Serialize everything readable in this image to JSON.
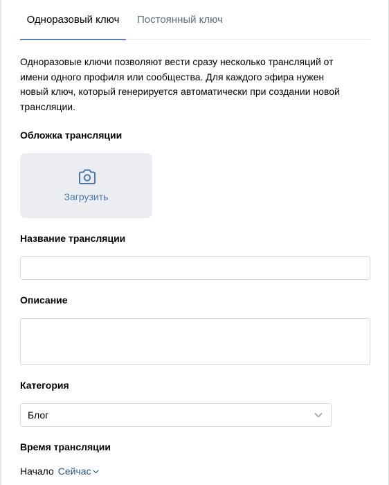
{
  "tabs": [
    {
      "label": "Одноразовый ключ",
      "active": true
    },
    {
      "label": "Постоянный ключ",
      "active": false
    }
  ],
  "intro": "Одноразовые ключи позволяют вести сразу несколько трансляций от имени одного профиля или сообщества. Для каждого эфира нужен новый ключ, который генерируется автоматически при создании новой трансляции.",
  "cover": {
    "label": "Обложка трансляции",
    "upload_label": "Загрузить",
    "icon": "camera-icon"
  },
  "name_field": {
    "label": "Название трансляции",
    "value": "",
    "placeholder": ""
  },
  "description_field": {
    "label": "Описание",
    "value": "",
    "placeholder": ""
  },
  "category": {
    "label": "Категория",
    "selected": "Блог",
    "icon": "chevron-down-icon"
  },
  "time": {
    "label": "Время трансляции",
    "start_label": "Начало",
    "start_value": "Сейчас",
    "icon": "chevron-down-icon"
  },
  "colors": {
    "accent": "#5181b8",
    "link": "#2a5885",
    "upload_text": "#4a76a8",
    "upload_bg": "#ebedf0",
    "border": "#d3d9de",
    "muted_tab": "#626d7a"
  }
}
